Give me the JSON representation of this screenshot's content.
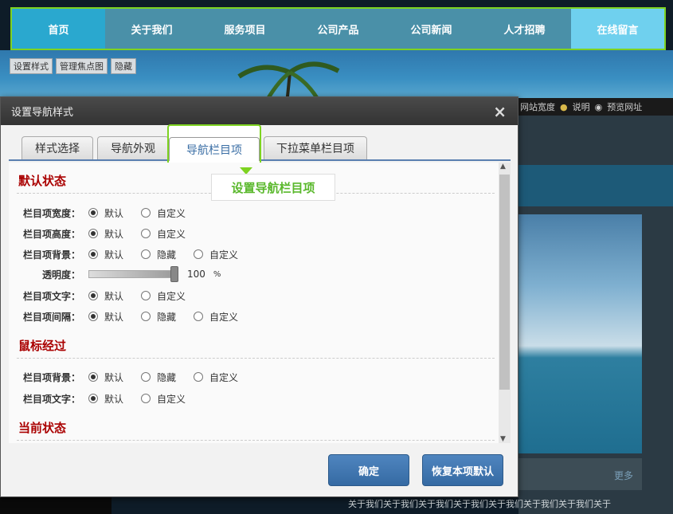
{
  "nav": {
    "items": [
      "首页",
      "关于我们",
      "服务项目",
      "公司产品",
      "公司新闻",
      "人才招聘",
      "在线留言"
    ]
  },
  "editbar": {
    "style": "设置样式",
    "focus": "管理焦点图",
    "hide": "隐藏"
  },
  "topbar": {
    "width_label": "网站宽度",
    "help_label": "说明",
    "preview_label": "预览网址"
  },
  "dialog": {
    "title": "设置导航样式",
    "close": "×",
    "tabs": [
      "样式选择",
      "导航外观",
      "导航栏目项",
      "下拉菜单栏目项"
    ],
    "callout": "设置导航栏目项",
    "sections": {
      "default": {
        "title": "默认状态",
        "rows": [
          {
            "label": "栏目项宽度：",
            "options": [
              "默认",
              "自定义"
            ],
            "selected": 0
          },
          {
            "label": "栏目项高度：",
            "options": [
              "默认",
              "自定义"
            ],
            "selected": 0
          },
          {
            "label": "栏目项背景：",
            "options": [
              "默认",
              "隐藏",
              "自定义"
            ],
            "selected": 0
          },
          {
            "label": "透明度：",
            "slider_value": "100",
            "unit": "%"
          },
          {
            "label": "栏目项文字：",
            "options": [
              "默认",
              "自定义"
            ],
            "selected": 0
          },
          {
            "label": "栏目项间隔：",
            "options": [
              "默认",
              "隐藏",
              "自定义"
            ],
            "selected": 0
          }
        ]
      },
      "hover": {
        "title": "鼠标经过",
        "rows": [
          {
            "label": "栏目项背景：",
            "options": [
              "默认",
              "隐藏",
              "自定义"
            ],
            "selected": 0
          },
          {
            "label": "栏目项文字：",
            "options": [
              "默认",
              "自定义"
            ],
            "selected": 0
          }
        ]
      },
      "current": {
        "title": "当前状态"
      }
    },
    "buttons": {
      "ok": "确定",
      "restore": "恢复本项默认"
    }
  },
  "page": {
    "more": "更多",
    "bottom_text": "关于我们关于我们关于我们关于我们关于我们关于我们关于我们关于"
  }
}
